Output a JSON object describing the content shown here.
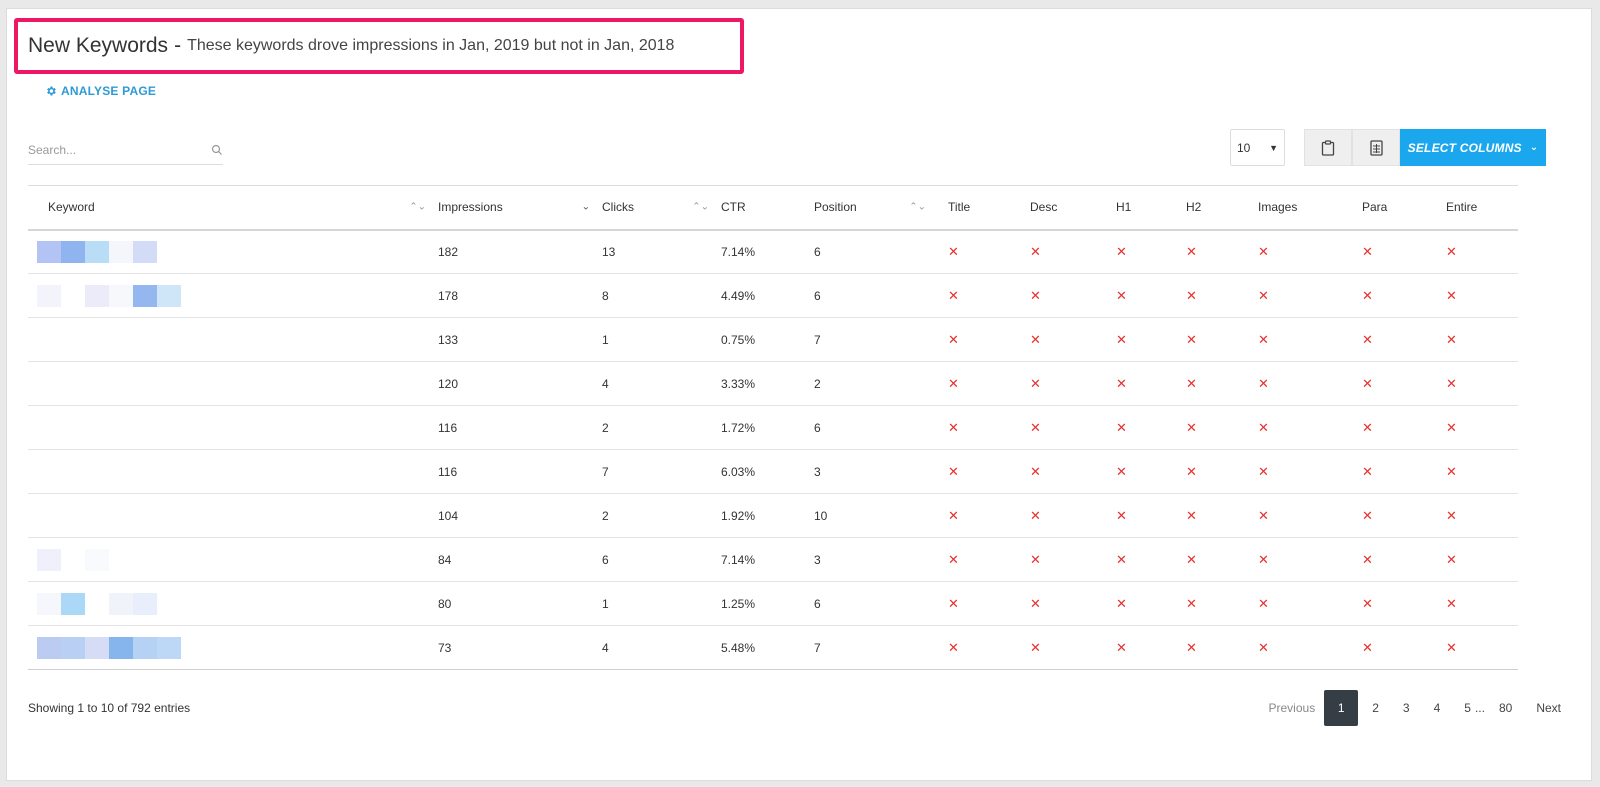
{
  "header": {
    "title": "New Keywords",
    "separator": "-",
    "subtitle": "These keywords drove impressions in Jan, 2019 but not in Jan, 2018"
  },
  "analyse": {
    "label": "ANALYSE PAGE"
  },
  "search": {
    "placeholder": "Search..."
  },
  "length": {
    "value": "10"
  },
  "toolbar": {
    "select_columns_label": "SELECT COLUMNS"
  },
  "table": {
    "columns": [
      "Keyword",
      "Impressions",
      "Clicks",
      "CTR",
      "Position",
      "Title",
      "Desc",
      "H1",
      "H2",
      "Images",
      "Para",
      "Entire"
    ],
    "rows": [
      {
        "impressions": "182",
        "clicks": "13",
        "ctr": "7.14%",
        "position": "6",
        "title": "✕",
        "desc": "✕",
        "h1": "✕",
        "h2": "✕",
        "images": "✕",
        "para": "✕",
        "entire": "✕"
      },
      {
        "impressions": "178",
        "clicks": "8",
        "ctr": "4.49%",
        "position": "6",
        "title": "✕",
        "desc": "✕",
        "h1": "✕",
        "h2": "✕",
        "images": "✕",
        "para": "✕",
        "entire": "✕"
      },
      {
        "impressions": "133",
        "clicks": "1",
        "ctr": "0.75%",
        "position": "7",
        "title": "✕",
        "desc": "✕",
        "h1": "✕",
        "h2": "✕",
        "images": "✕",
        "para": "✕",
        "entire": "✕"
      },
      {
        "impressions": "120",
        "clicks": "4",
        "ctr": "3.33%",
        "position": "2",
        "title": "✕",
        "desc": "✕",
        "h1": "✕",
        "h2": "✕",
        "images": "✕",
        "para": "✕",
        "entire": "✕"
      },
      {
        "impressions": "116",
        "clicks": "2",
        "ctr": "1.72%",
        "position": "6",
        "title": "✕",
        "desc": "✕",
        "h1": "✕",
        "h2": "✕",
        "images": "✕",
        "para": "✕",
        "entire": "✕"
      },
      {
        "impressions": "116",
        "clicks": "7",
        "ctr": "6.03%",
        "position": "3",
        "title": "✕",
        "desc": "✕",
        "h1": "✕",
        "h2": "✕",
        "images": "✕",
        "para": "✕",
        "entire": "✕"
      },
      {
        "impressions": "104",
        "clicks": "2",
        "ctr": "1.92%",
        "position": "10",
        "title": "✕",
        "desc": "✕",
        "h1": "✕",
        "h2": "✕",
        "images": "✕",
        "para": "✕",
        "entire": "✕"
      },
      {
        "impressions": "84",
        "clicks": "6",
        "ctr": "7.14%",
        "position": "3",
        "title": "✕",
        "desc": "✕",
        "h1": "✕",
        "h2": "✕",
        "images": "✕",
        "para": "✕",
        "entire": "✕"
      },
      {
        "impressions": "80",
        "clicks": "1",
        "ctr": "1.25%",
        "position": "6",
        "title": "✕",
        "desc": "✕",
        "h1": "✕",
        "h2": "✕",
        "images": "✕",
        "para": "✕",
        "entire": "✕"
      },
      {
        "impressions": "73",
        "clicks": "4",
        "ctr": "5.48%",
        "position": "7",
        "title": "✕",
        "desc": "✕",
        "h1": "✕",
        "h2": "✕",
        "images": "✕",
        "para": "✕",
        "entire": "✕"
      }
    ],
    "keyword_blur_colors": [
      [
        "#b3c3f3",
        "#8fb4ef",
        "#b9dcf7",
        "#f4f6fb",
        "#d3dcf6",
        "#ffffff"
      ],
      [
        "#f3f3fb",
        "#ffffff",
        "#ecebf9",
        "#f7f8fc",
        "#94b7ef",
        "#cfe5f8"
      ],
      [],
      [],
      [],
      [],
      [],
      [
        "#eff0fb",
        "#ffffff",
        "#f8fafd",
        "#ffffff",
        "#ffffff",
        "#ffffff"
      ],
      [
        "#f6f7fc",
        "#acd8f8",
        "#ffffff",
        "#f1f3fb",
        "#e8eefb",
        "#ffffff"
      ],
      [
        "#bccbf2",
        "#b9cff3",
        "#d6dcf6",
        "#86b5ee",
        "#b5d2f4",
        "#bcd8f6"
      ]
    ]
  },
  "footer": {
    "info": "Showing 1 to 10 of 792 entries",
    "previous": "Previous",
    "pages": [
      "1",
      "2",
      "3",
      "4",
      "5"
    ],
    "ellipsis": "...",
    "last_page": "80",
    "next": "Next"
  },
  "colors": {
    "accent": "#1aa7ee",
    "highlight_border": "#ee1764",
    "cross": "#e53131",
    "active_page": "#353d45",
    "link": "#2e9bd6"
  },
  "icons": {
    "analyse": "gear-icon",
    "search": "search-icon",
    "copy": "clipboard-icon",
    "export": "spreadsheet-icon",
    "sort": "sort-icon",
    "sort_desc": "chevron-down-icon"
  }
}
